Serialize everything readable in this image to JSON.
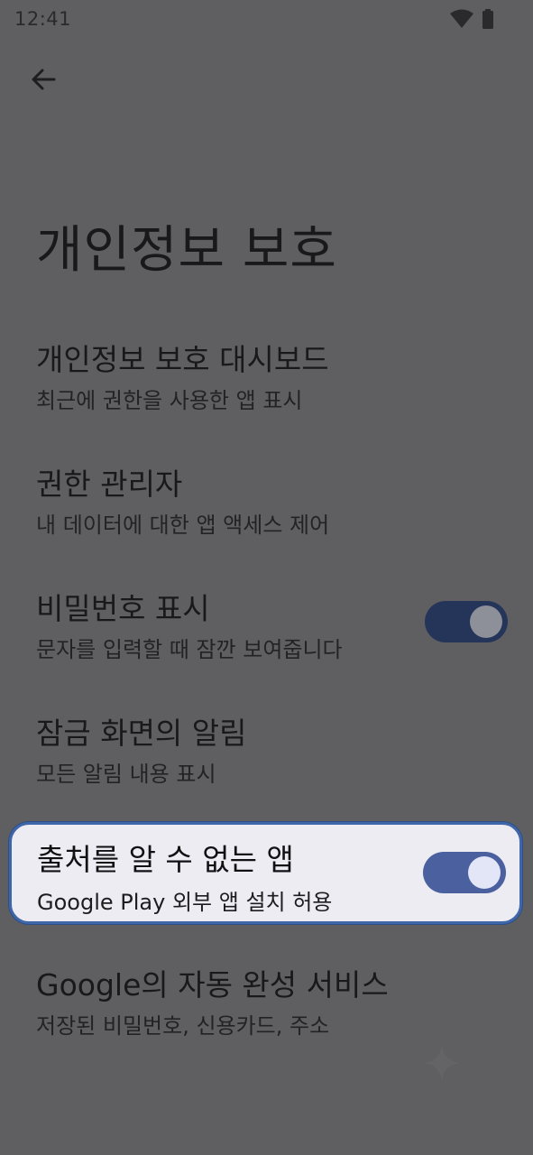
{
  "status_bar": {
    "time": "12:41",
    "icons": [
      "wifi-icon",
      "battery-icon"
    ]
  },
  "header": {
    "back_icon": "arrow-left-icon",
    "title": "개인정보 보호"
  },
  "items": [
    {
      "title": "개인정보 보호 대시보드",
      "subtitle": "최근에 권한을 사용한 앱 표시"
    },
    {
      "title": "권한 관리자",
      "subtitle": "내 데이터에 대한 앱 액세스 제어"
    },
    {
      "title": "비밀번호 표시",
      "subtitle": "문자를 입력할 때 잠깐 보여줍니다",
      "toggle": true
    },
    {
      "title": "잠금 화면의 알림",
      "subtitle": "모든 알림 내용 표시"
    },
    {
      "title": "출처를 알 수 없는 앱",
      "subtitle": "Google Play 외부 앱 설치 허용",
      "toggle": true,
      "highlighted": true
    },
    {
      "title": "Google의 자동 완성 서비스",
      "subtitle": "저장된 비밀번호, 신용카드, 주소"
    }
  ],
  "colors": {
    "scrim_background": "#5f5f61",
    "toggle_track_dim": "#25355a",
    "toggle_knob_dim": "#8d8f99",
    "toggle_track": "#4a609f",
    "toggle_knob": "#e3e6f7",
    "highlight_border": "#3e66a8",
    "highlight_bg": "#ececf2"
  }
}
